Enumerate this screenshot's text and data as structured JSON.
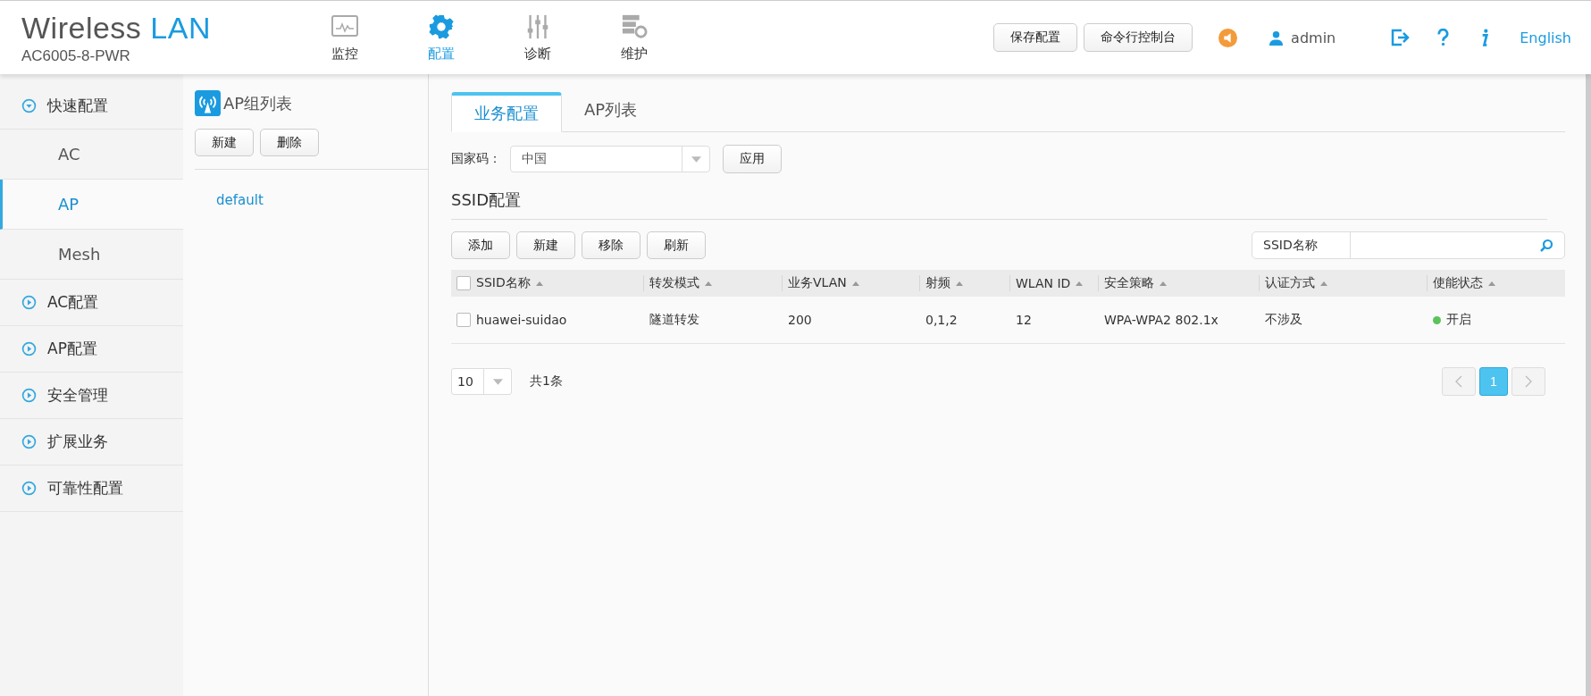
{
  "header": {
    "title": "Wireless",
    "title_accent": "LAN",
    "model": "AC6005-8-PWR"
  },
  "nav": [
    {
      "label": "监控",
      "kind": "monitor",
      "selected": false
    },
    {
      "label": "配置",
      "kind": "gear",
      "selected": true
    },
    {
      "label": "诊断",
      "kind": "sliders",
      "selected": false
    },
    {
      "label": "维护",
      "kind": "server",
      "selected": false
    }
  ],
  "header_buttons": [
    "保存配置",
    "命令行控制台"
  ],
  "user": "admin",
  "language": "English",
  "sidebar": {
    "items": [
      {
        "label": "快速配置",
        "expanded": true,
        "children": [
          {
            "label": "AC",
            "selected": false
          },
          {
            "label": "AP",
            "selected": true
          },
          {
            "label": "Mesh",
            "selected": false
          }
        ]
      },
      {
        "label": "AC配置",
        "expanded": false
      },
      {
        "label": "AP配置",
        "expanded": false
      },
      {
        "label": "安全管理",
        "expanded": false
      },
      {
        "label": "扩展业务",
        "expanded": false
      },
      {
        "label": "可靠性配置",
        "expanded": false
      }
    ]
  },
  "group_panel": {
    "title": "AP组列表",
    "buttons": [
      "新建",
      "删除"
    ],
    "items": [
      "default"
    ]
  },
  "tabs": [
    {
      "label": "业务配置",
      "selected": true
    },
    {
      "label": "AP列表",
      "selected": false
    }
  ],
  "country": {
    "label": "国家码：",
    "value": "中国",
    "apply": "应用"
  },
  "ssid": {
    "title": "SSID配置",
    "buttons": [
      "添加",
      "新建",
      "移除",
      "刷新"
    ],
    "search_label": "SSID名称"
  },
  "table": {
    "all_checked": false,
    "columns": [
      "SSID名称",
      "转发模式",
      "业务VLAN",
      "射频",
      "WLAN ID",
      "安全策略",
      "认证方式",
      "使能状态"
    ],
    "rows": [
      {
        "checked": false,
        "cells": [
          "huawei-suidao",
          "隧道转发",
          "200",
          "0,1,2",
          "12",
          "WPA-WPA2 802.1x",
          "不涉及"
        ],
        "status": "开启",
        "color": "#5cc35a"
      }
    ]
  },
  "pager": {
    "page_size": "10",
    "total": "共1条",
    "pages": [
      {
        "label": "1",
        "selected": true
      }
    ]
  }
}
